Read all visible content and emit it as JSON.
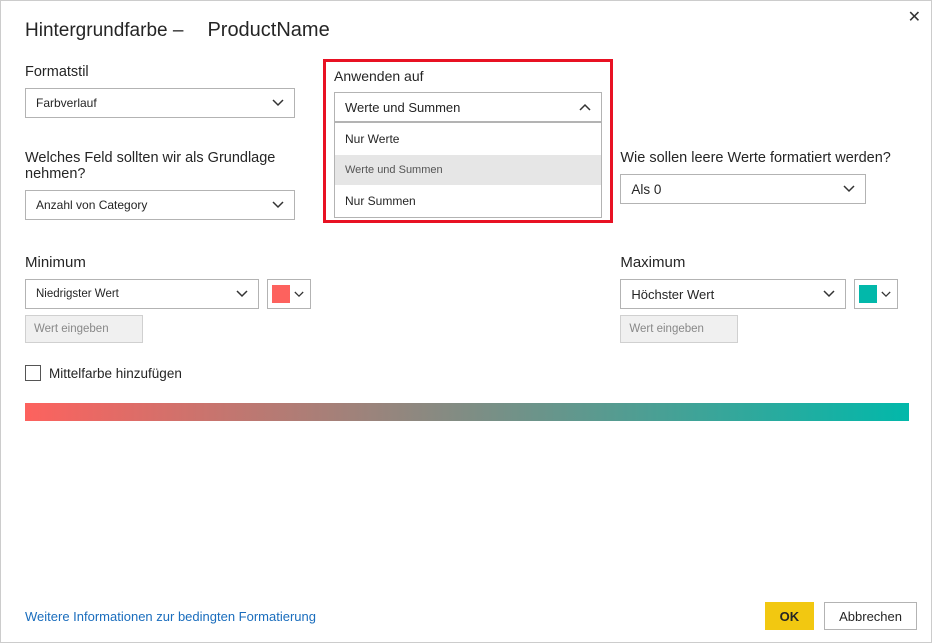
{
  "header": {
    "title_prefix": "Hintergrundfarbe –",
    "title_field": "ProductName"
  },
  "format_style": {
    "label": "Formatstil",
    "value": "Farbverlauf"
  },
  "apply_to": {
    "label": "Anwenden auf",
    "value": "Werte und Summen",
    "options": [
      "Nur Werte",
      "Werte und Summen",
      "Nur Summen"
    ]
  },
  "base_field": {
    "label": "Welches Feld sollten wir als Grundlage nehmen?",
    "value": "Anzahl von Category"
  },
  "empty_values": {
    "label": "Wie sollen leere Werte formatiert werden?",
    "value": "Als 0"
  },
  "minimum": {
    "label": "Minimum",
    "mode": "Niedrigster Wert",
    "placeholder": "Wert eingeben",
    "color": "#fd625e"
  },
  "maximum": {
    "label": "Maximum",
    "mode": "Höchster Wert",
    "placeholder": "Wert eingeben",
    "color": "#02b8aa"
  },
  "add_middle": {
    "label": "Mittelfarbe hinzufügen",
    "checked": false
  },
  "footer": {
    "link": "Weitere Informationen zur bedingten Formatierung",
    "ok": "OK",
    "cancel": "Abbrechen"
  }
}
